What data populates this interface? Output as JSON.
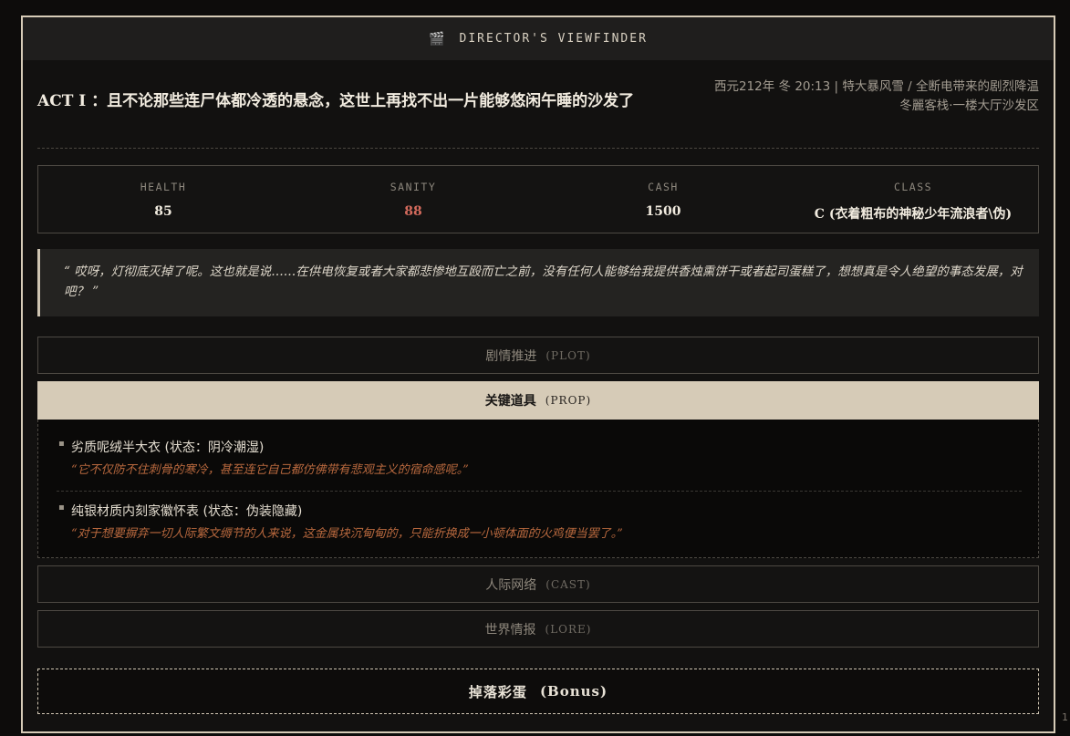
{
  "window": {
    "title": "DIRECTOR'S VIEWFINDER",
    "title_icon": "clapperboard-icon"
  },
  "scene": {
    "act_title": "ACT I ：且不论那些连尸体都冷透的悬念，这世上再找不出一片能够悠闲午睡的沙发了",
    "time_weather": "西元212年 冬 20:13 | 特大暴风雪 / 全断电带来的剧烈降温",
    "location": "冬麗客栈·一楼大厅沙发区"
  },
  "stats": [
    {
      "label": "HEALTH",
      "value": "85"
    },
    {
      "label": "SANITY",
      "value": "88"
    },
    {
      "label": "CASH",
      "value": "1500"
    },
    {
      "label": "CLASS",
      "value": "C (衣着粗布的神秘少年流浪者\\伪)"
    }
  ],
  "quote": "“ 哎呀，灯彻底灭掉了呢。这也就是说……在供电恢复或者大家都悲惨地互殴而亡之前，没有任何人能够给我提供香烛熏饼干或者起司蛋糕了，想想真是令人绝望的事态发展，对吧？ ”",
  "tabs": [
    {
      "label": "剧情推进",
      "en": "(PLOT)"
    },
    {
      "label": "关键道具",
      "en": "(PROP)"
    },
    {
      "label": "人际网络",
      "en": "(CAST)"
    },
    {
      "label": "世界情报",
      "en": "(LORE)"
    }
  ],
  "props": [
    {
      "name": "劣质呢绒半大衣 (状态：阴冷潮湿)",
      "desc": "“它不仅防不住刺骨的寒冷，甚至连它自己都仿佛带有悲观主义的宿命感呢。”"
    },
    {
      "name": "纯银材质内刻家徽怀表 (状态：伪装隐藏)",
      "desc": "“对于想要摒弃一切人际繁文缛节的人来说，这金属块沉甸甸的，只能折换成一小顿体面的火鸡便当罢了。”"
    }
  ],
  "bonus": {
    "label": "掉落彩蛋",
    "en": "(Bonus)"
  },
  "scroll_indicator": "1",
  "colors": {
    "accent": "#d6cbb7",
    "sanity": "#d36a5c",
    "prop_desc": "#b8683e"
  }
}
